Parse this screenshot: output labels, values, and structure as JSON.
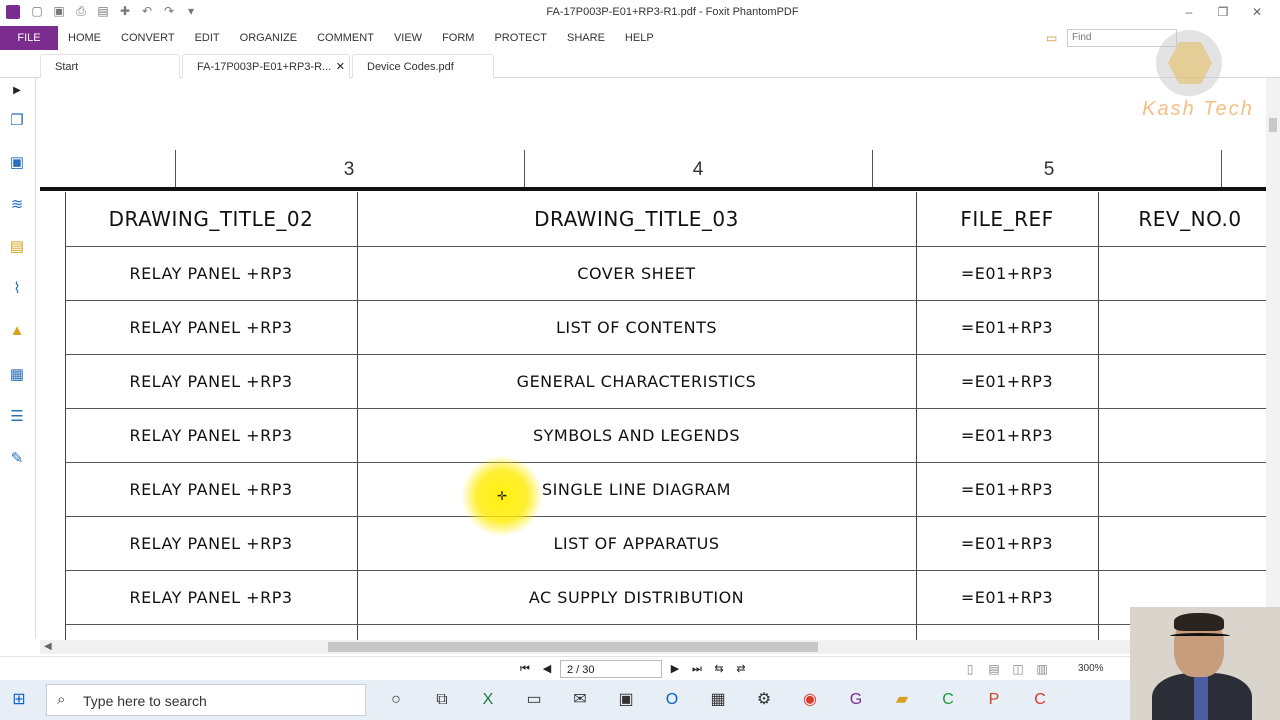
{
  "window": {
    "title": "FA-17P003P-E01+RP3-R1.pdf - Foxit PhantomPDF",
    "qat_icons": [
      "open-icon",
      "save-icon",
      "print-icon",
      "scan-icon",
      "new-icon",
      "undo-icon",
      "redo-icon",
      "customize-icon"
    ],
    "controls": [
      "minimize-icon",
      "restore-icon",
      "close-icon"
    ]
  },
  "menu": {
    "file": "FILE",
    "items": [
      "HOME",
      "CONVERT",
      "EDIT",
      "ORGANIZE",
      "COMMENT",
      "VIEW",
      "FORM",
      "PROTECT",
      "SHARE",
      "HELP"
    ],
    "find_placeholder": "Find"
  },
  "tabs": [
    {
      "label": "Start"
    },
    {
      "label": "FA-17P003P-E01+RP3-R...",
      "active": true
    },
    {
      "label": "Device Codes.pdf"
    }
  ],
  "leftnav": [
    "expand-icon",
    "bookmark-icon",
    "pages-icon",
    "layers-icon",
    "comments-icon",
    "attachments-icon",
    "security-icon",
    "file-info-icon",
    "form-fields-icon",
    "tools-icon"
  ],
  "drawing": {
    "column_numbers": [
      "3",
      "4",
      "5"
    ],
    "headers": [
      "DRAWING_TITLE_02",
      "DRAWING_TITLE_03",
      "FILE_REF",
      "REV_NO.0"
    ],
    "rows": [
      [
        "RELAY PANEL +RP3",
        "COVER SHEET",
        "=E01+RP3",
        ""
      ],
      [
        "RELAY PANEL +RP3",
        "LIST OF CONTENTS",
        "=E01+RP3",
        ""
      ],
      [
        "RELAY PANEL +RP3",
        "GENERAL CHARACTERISTICS",
        "=E01+RP3",
        ""
      ],
      [
        "RELAY PANEL +RP3",
        "SYMBOLS AND LEGENDS",
        "=E01+RP3",
        ""
      ],
      [
        "RELAY PANEL +RP3",
        "SINGLE LINE DIAGRAM",
        "=E01+RP3",
        ""
      ],
      [
        "RELAY PANEL +RP3",
        "LIST OF APPARATUS",
        "=E01+RP3",
        ""
      ],
      [
        "RELAY PANEL +RP3",
        "AC SUPPLY DISTRIBUTION",
        "=E01+RP3",
        ""
      ]
    ]
  },
  "status": {
    "page": "2 / 30",
    "zoom": "300%"
  },
  "taskbar": {
    "search_placeholder": "Type here to search",
    "apps": [
      "cortana-icon",
      "task-view-icon",
      "excel-icon",
      "snipping-icon",
      "mail-icon",
      "store-icon",
      "outlook-icon",
      "calculator-icon",
      "settings-icon",
      "chrome-icon",
      "foxit-icon",
      "explorer-icon",
      "camtasia-icon",
      "powerpoint-icon",
      "recorder-icon"
    ]
  },
  "watermark": {
    "text": "Kash Tech"
  },
  "colors": {
    "accent": "#7a2d8e",
    "highlight": "#ffeb00"
  }
}
